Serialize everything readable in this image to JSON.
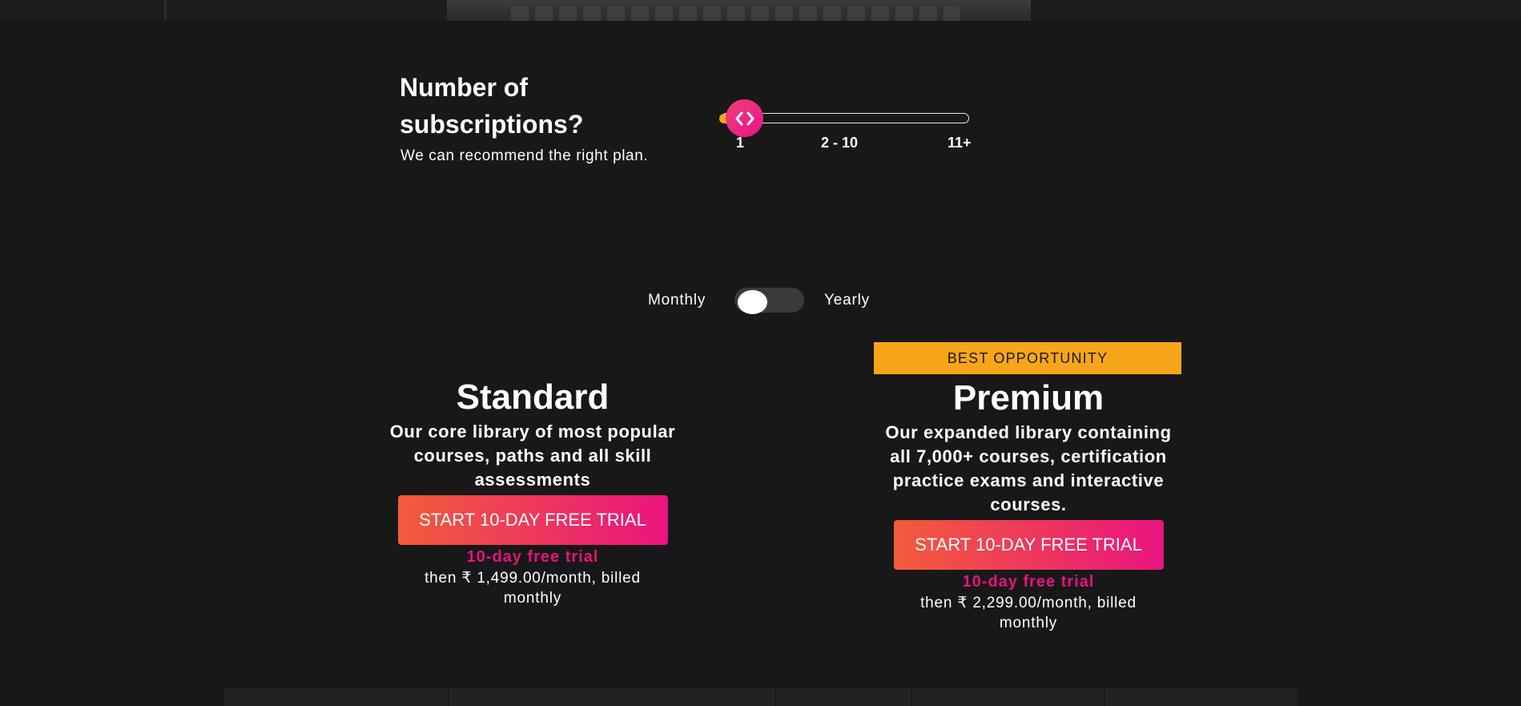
{
  "subscriptions": {
    "heading": "Number of subscriptions?",
    "subheading": "We can recommend the right plan.",
    "slider": {
      "ticks": [
        "1",
        "2 - 10",
        "11+"
      ],
      "selected": "1",
      "thumb_icon": "chevrons-left-right-icon",
      "accent": "#e8128b",
      "fill_color": "#f4a81e"
    }
  },
  "billing": {
    "monthly_label": "Monthly",
    "yearly_label": "Yearly",
    "selected": "Monthly"
  },
  "plans": [
    {
      "name": "Standard",
      "description": "Our core library of most popular courses, paths and all skill assessments",
      "cta_label": "START 10-DAY FREE TRIAL",
      "trial_note": "10-day free trial",
      "price_note": "then ₹ 1,499.00/month, billed monthly"
    },
    {
      "badge": "BEST OPPORTUNITY",
      "name": "Premium",
      "description": "Our expanded library containing all 7,000+ courses, certification practice exams and interactive courses.",
      "cta_label": "START 10-DAY FREE TRIAL",
      "trial_note": "10-day free trial",
      "price_note": "then ₹ 2,299.00/month, billed monthly"
    }
  ],
  "colors": {
    "background": "#181818",
    "badge": "#f7a619",
    "cta_gradient_start": "#f25c3a",
    "cta_gradient_end": "#ea147f",
    "trial_text": "#e8127f"
  }
}
